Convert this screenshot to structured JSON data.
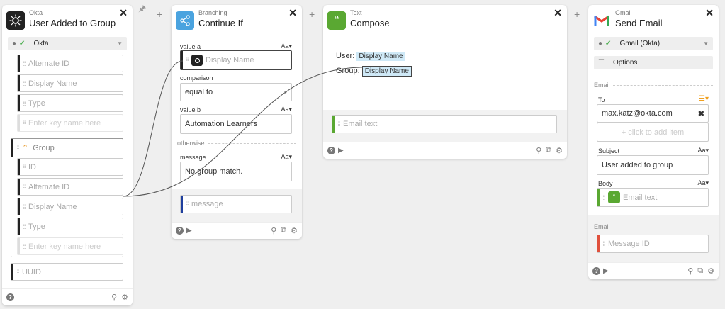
{
  "okta": {
    "kind": "Okta",
    "title": "User Added to Group",
    "account": "Okta",
    "fields": [
      "Alternate ID",
      "Display Name",
      "Type"
    ],
    "enter_key_placeholder": "Enter key name here",
    "group_label": "Group",
    "group_fields": [
      "ID",
      "Alternate ID",
      "Display Name",
      "Type"
    ],
    "group_enter_key_placeholder": "Enter key name here",
    "uuid_label": "UUID"
  },
  "branching": {
    "kind": "Branching",
    "title": "Continue If",
    "value_a_label": "value a",
    "value_a_chip": "Display Name",
    "comparison_label": "comparison",
    "comparison_value": "equal to",
    "value_b_label": "value b",
    "value_b_value": "Automation Learners",
    "otherwise_label": "otherwise",
    "message_label": "message",
    "message_value": "No group match.",
    "message_output": "message",
    "aa": "Aa▾"
  },
  "compose": {
    "kind": "Text",
    "title": "Compose",
    "user_label": "User:",
    "user_chip": "Display Name",
    "group_label": "Group:",
    "group_chip": "Display Name",
    "output": "Email text"
  },
  "gmail": {
    "kind": "Gmail",
    "title": "Send Email",
    "account": "Gmail (Okta)",
    "options_label": "Options",
    "email_section": "Email",
    "to_label": "To",
    "to_value": "max.katz@okta.com",
    "add_item_placeholder": "+ click to add item",
    "subject_label": "Subject",
    "subject_value": "User added to group",
    "body_label": "Body",
    "body_chip": "Email text",
    "output_section": "Email",
    "output_field": "Message ID",
    "aa": "Aa▾"
  },
  "colors": {
    "okta_icon": "#222222",
    "branching_icon": "#4aa3df",
    "text_icon": "#5aa832",
    "chip_bg": "#cfe9f7",
    "accent_blue": "#1f3f9e",
    "accent_red": "#e0503c",
    "accent_green": "#5aa832",
    "list_icon": "#f0a020"
  }
}
